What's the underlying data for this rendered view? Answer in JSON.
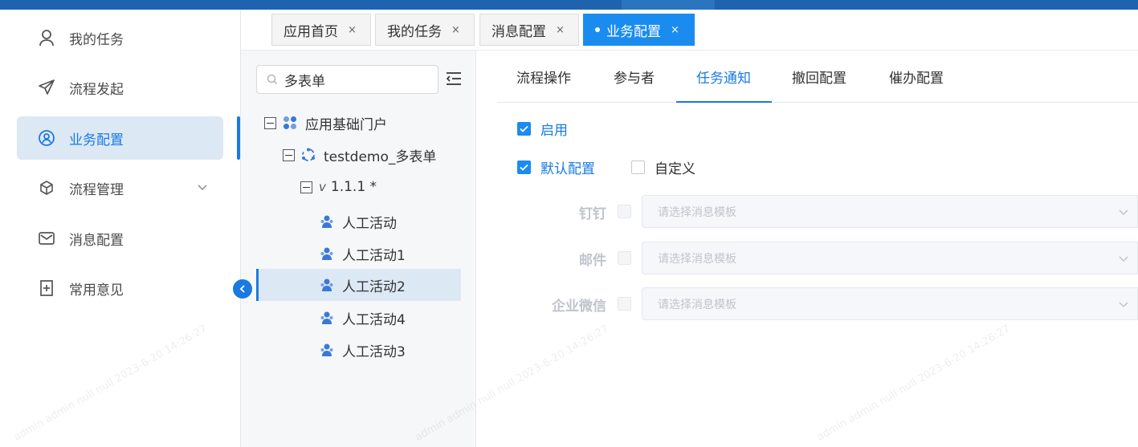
{
  "sidebar": {
    "items": [
      {
        "label": "我的任务",
        "icon": "user-icon"
      },
      {
        "label": "流程发起",
        "icon": "send-icon"
      },
      {
        "label": "业务配置",
        "icon": "user-circle-icon",
        "active": true
      },
      {
        "label": "流程管理",
        "icon": "cube-icon"
      },
      {
        "label": "消息配置",
        "icon": "mail-icon"
      },
      {
        "label": "常用意见",
        "icon": "add-note-icon"
      }
    ]
  },
  "page_tabs": [
    {
      "label": "应用首页"
    },
    {
      "label": "我的任务"
    },
    {
      "label": "消息配置"
    },
    {
      "label": "业务配置",
      "active": true
    }
  ],
  "tab_close_glyph": "×",
  "tree": {
    "search_value": "多表单",
    "nodes": [
      {
        "label": "应用基础门户"
      },
      {
        "label": "testdemo_多表单"
      },
      {
        "label": "1.1.1 *",
        "prefix": "v"
      },
      {
        "label": "人工活动"
      },
      {
        "label": "人工活动1"
      },
      {
        "label": "人工活动2",
        "selected": true
      },
      {
        "label": "人工活动4"
      },
      {
        "label": "人工活动3"
      }
    ]
  },
  "config_tabs": [
    {
      "label": "流程操作"
    },
    {
      "label": "参与者"
    },
    {
      "label": "任务通知",
      "active": true
    },
    {
      "label": "撤回配置"
    },
    {
      "label": "催办配置"
    }
  ],
  "notify": {
    "enable_label": "启用",
    "default_label": "默认配置",
    "custom_label": "自定义",
    "channels": [
      {
        "label": "钉钉",
        "placeholder": "请选择消息模板"
      },
      {
        "label": "邮件",
        "placeholder": "请选择消息模板"
      },
      {
        "label": "企业微信",
        "placeholder": "请选择消息模板"
      }
    ]
  },
  "watermark": "admin admin null null 2023-6-20 14:26:27",
  "colors": {
    "accent": "#1a7ae0",
    "topbar": "#1d63ad",
    "active_bg": "#dde8f5"
  }
}
